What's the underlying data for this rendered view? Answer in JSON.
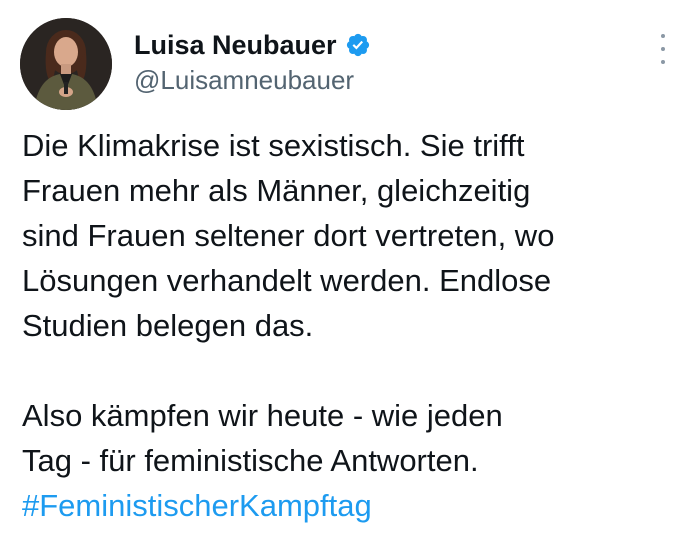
{
  "tweet": {
    "author": {
      "display_name": "Luisa Neubauer",
      "handle": "@Luisamneubauer",
      "verified_icon": "verified-badge-icon",
      "verified_color": "#1d9bf0"
    },
    "menu_icon": "more-options-icon",
    "paragraph1": [
      "Die Klimakrise ist sexistisch. Sie trifft",
      "Frauen mehr als Männer, gleichzeitig",
      "sind Frauen seltener dort vertreten, wo",
      "Lösungen verhandelt werden. Endlose",
      "Studien belegen das."
    ],
    "paragraph2": [
      "Also kämpfen wir heute - wie jeden",
      "Tag - für feministische Antworten."
    ],
    "hashtag": "#FeministischerKampftag",
    "hashtag_color": "#1d9bf0"
  }
}
